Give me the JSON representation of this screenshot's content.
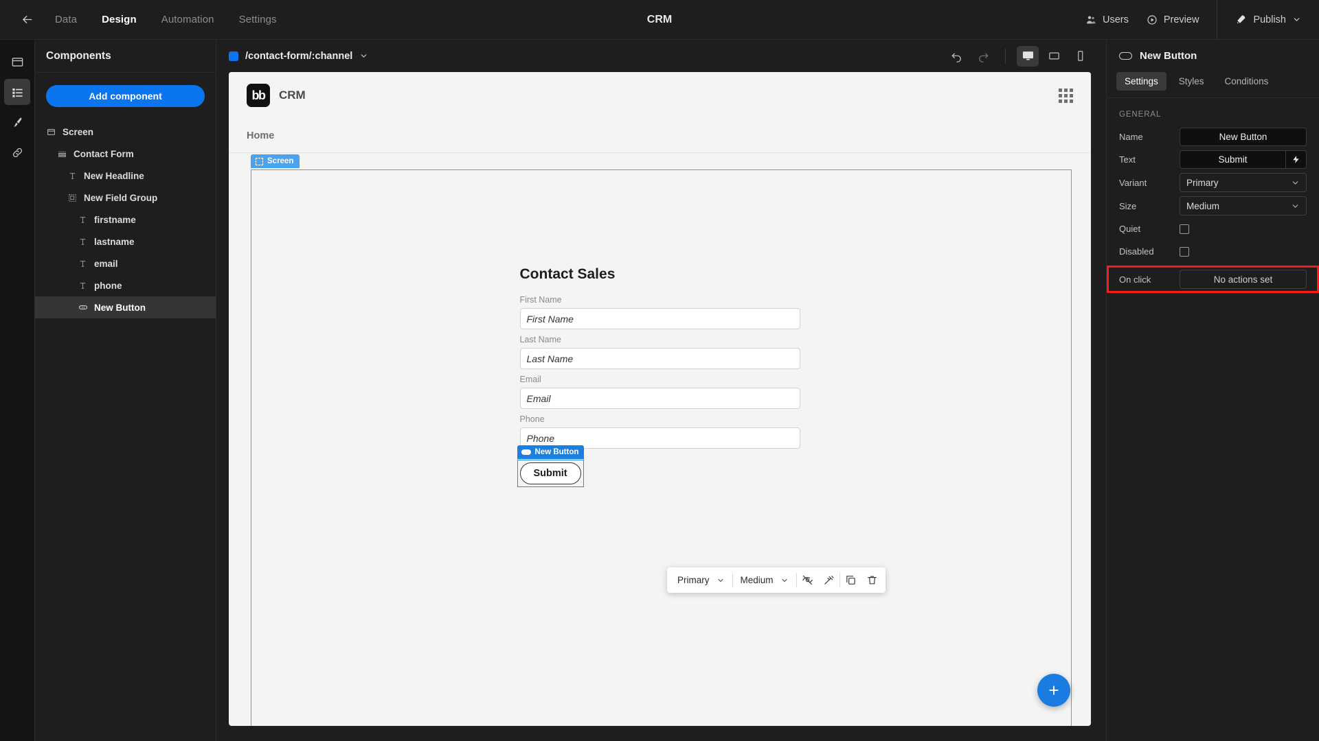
{
  "topbar": {
    "back_icon": "arrow-left-icon",
    "nav": [
      {
        "label": "Data",
        "active": false
      },
      {
        "label": "Design",
        "active": true
      },
      {
        "label": "Automation",
        "active": false
      },
      {
        "label": "Settings",
        "active": false
      }
    ],
    "title": "CRM",
    "users_label": "Users",
    "preview_label": "Preview",
    "publish_label": "Publish"
  },
  "rail": {
    "items": [
      {
        "icon": "screen-icon",
        "active": false
      },
      {
        "icon": "components-list-icon",
        "active": true
      },
      {
        "icon": "paintbrush-icon",
        "active": false
      },
      {
        "icon": "link-icon",
        "active": false
      }
    ]
  },
  "components": {
    "header": "Components",
    "add_button": "Add component",
    "tree": [
      {
        "label": "Screen",
        "icon": "screen-icon",
        "indent": 0,
        "selected": false
      },
      {
        "label": "Contact Form",
        "icon": "form-icon",
        "indent": 1,
        "selected": false
      },
      {
        "label": "New Headline",
        "icon": "text-icon",
        "indent": 2,
        "selected": false
      },
      {
        "label": "New Field Group",
        "icon": "field-group-icon",
        "indent": 2,
        "selected": false
      },
      {
        "label": "firstname",
        "icon": "text-icon",
        "indent": 3,
        "selected": false
      },
      {
        "label": "lastname",
        "icon": "text-icon",
        "indent": 3,
        "selected": false
      },
      {
        "label": "email",
        "icon": "text-icon",
        "indent": 3,
        "selected": false
      },
      {
        "label": "phone",
        "icon": "text-icon",
        "indent": 3,
        "selected": false
      },
      {
        "label": "New Button",
        "icon": "button-pill-icon",
        "indent": 3,
        "selected": true
      }
    ]
  },
  "canvas_toolbar": {
    "route": "/contact-form/:channel",
    "undo_icon": "undo-icon",
    "redo_icon": "redo-icon",
    "devices": [
      {
        "icon": "desktop-icon",
        "active": true
      },
      {
        "icon": "tablet-icon",
        "active": false
      },
      {
        "icon": "mobile-icon",
        "active": false
      }
    ]
  },
  "preview": {
    "logo_text": "bb",
    "brand": "CRM",
    "grid_icon": "grid-apps-icon",
    "nav_item": "Home",
    "screen_badge": "Screen",
    "form": {
      "title": "Contact Sales",
      "fields": [
        {
          "label": "First Name",
          "placeholder": "First Name"
        },
        {
          "label": "Last Name",
          "placeholder": "Last Name"
        },
        {
          "label": "Email",
          "placeholder": "Email"
        },
        {
          "label": "Phone",
          "placeholder": "Phone"
        }
      ],
      "submit_label": "Submit",
      "submit_tag": "New Button"
    },
    "fab_label": "+"
  },
  "edit_toolbar": {
    "variant": "Primary",
    "size": "Medium",
    "buttons": [
      {
        "icon": "eye-off-icon"
      },
      {
        "icon": "unlink-icon"
      },
      {
        "icon": "duplicate-icon"
      },
      {
        "icon": "trash-icon"
      }
    ]
  },
  "settings": {
    "title": "New Button",
    "tabs": [
      {
        "label": "Settings",
        "active": true
      },
      {
        "label": "Styles",
        "active": false
      },
      {
        "label": "Conditions",
        "active": false
      }
    ],
    "section_title": "GENERAL",
    "rows": {
      "name_label": "Name",
      "name_value": "New Button",
      "text_label": "Text",
      "text_value": "Submit",
      "variant_label": "Variant",
      "variant_value": "Primary",
      "size_label": "Size",
      "size_value": "Medium",
      "quiet_label": "Quiet",
      "disabled_label": "Disabled",
      "onclick_label": "On click",
      "onclick_value": "No actions set"
    }
  },
  "colors": {
    "accent": "#0b75f0",
    "highlight": "#ff1a1a",
    "selection": "#4aa3ef",
    "panel_bg": "#1e1e1e",
    "canvas_bg": "#f4f4f4"
  }
}
